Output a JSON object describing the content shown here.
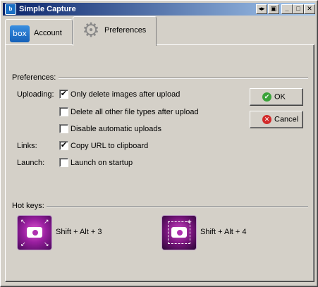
{
  "window": {
    "title": "Simple Capture",
    "icon": "box-app-icon"
  },
  "titlebar_buttons": {
    "pin": "◂▸",
    "restore": "▣",
    "minimize": "_",
    "maximize": "□",
    "close": "✕"
  },
  "tabs": [
    {
      "label": "Account",
      "icon": "box-logo",
      "logo_text": "box",
      "active": false
    },
    {
      "label": "Preferences",
      "icon": "gear-icon",
      "active": true
    }
  ],
  "preferences": {
    "section_label": "Preferences:",
    "uploading_label": "Uploading:",
    "links_label": "Links:",
    "launch_label": "Launch:",
    "options": [
      {
        "label": "Only delete images after upload",
        "checked": true
      },
      {
        "label": "Delete all other file types after upload",
        "checked": false
      },
      {
        "label": "Disable automatic uploads",
        "checked": false
      },
      {
        "label": "Copy URL to clipboard",
        "checked": true
      },
      {
        "label": "Launch on startup",
        "checked": false
      }
    ],
    "check_mark": "✔"
  },
  "buttons": {
    "ok": "OK",
    "cancel": "Cancel"
  },
  "hotkeys": {
    "section_label": "Hot keys:",
    "items": [
      {
        "shortcut": "Shift + Alt + 3",
        "icon": "fullscreen-capture-icon"
      },
      {
        "shortcut": "Shift + Alt + 4",
        "icon": "region-capture-icon"
      }
    ]
  },
  "colors": {
    "title_bar_start": "#0a246a",
    "title_bar_end": "#a6caf0",
    "face": "#d4d0c8",
    "ok_green": "#3aa33a",
    "cancel_red": "#d22a2a"
  }
}
